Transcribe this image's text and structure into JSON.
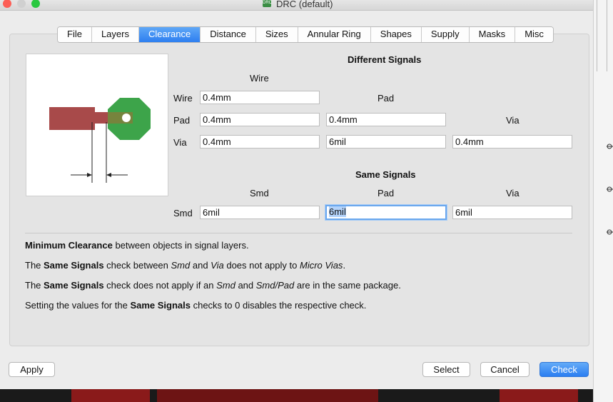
{
  "window": {
    "title": "DRC (default)",
    "icon": "drc-app-icon"
  },
  "tabs": [
    {
      "label": "File"
    },
    {
      "label": "Layers"
    },
    {
      "label": "Clearance",
      "active": true
    },
    {
      "label": "Distance"
    },
    {
      "label": "Sizes"
    },
    {
      "label": "Annular Ring"
    },
    {
      "label": "Shapes"
    },
    {
      "label": "Supply"
    },
    {
      "label": "Masks"
    },
    {
      "label": "Misc"
    }
  ],
  "different_signals": {
    "heading": "Different Signals",
    "col_wire": "Wire",
    "col_pad": "Pad",
    "col_via": "Via",
    "row_wire": "Wire",
    "row_pad": "Pad",
    "row_via": "Via",
    "wire_wire": "0.4mm",
    "pad_wire": "0.4mm",
    "pad_pad": "0.4mm",
    "via_wire": "0.4mm",
    "via_pad": "6mil",
    "via_via": "0.4mm"
  },
  "same_signals": {
    "heading": "Same Signals",
    "col_smd": "Smd",
    "col_pad": "Pad",
    "col_via": "Via",
    "row_smd": "Smd",
    "smd_smd": "6mil",
    "smd_pad": "6mil",
    "smd_via": "6mil"
  },
  "info": {
    "l1_b": "Minimum Clearance",
    "l1_t": " between objects in signal layers.",
    "l2_a": "The ",
    "l2_b": "Same Signals",
    "l2_c": " check between ",
    "l2_i1": "Smd",
    "l2_d": " and ",
    "l2_i2": "Via",
    "l2_e": " does not apply to ",
    "l2_i3": "Micro Vias",
    "l2_f": ".",
    "l3_a": "The ",
    "l3_b": "Same Signals",
    "l3_c": " check does not apply if an ",
    "l3_i1": "Smd",
    "l3_d": " and ",
    "l3_i2": "Smd/Pad",
    "l3_e": " are in the same package.",
    "l4_a": "Setting the values for the ",
    "l4_b": "Same Signals",
    "l4_c": " checks to 0 disables the respective check."
  },
  "buttons": {
    "apply": "Apply",
    "select": "Select",
    "cancel": "Cancel",
    "check": "Check"
  },
  "colors": {
    "accent": "#2d7ef0",
    "wire": "#a33a3a",
    "pad": "#3aa343"
  }
}
